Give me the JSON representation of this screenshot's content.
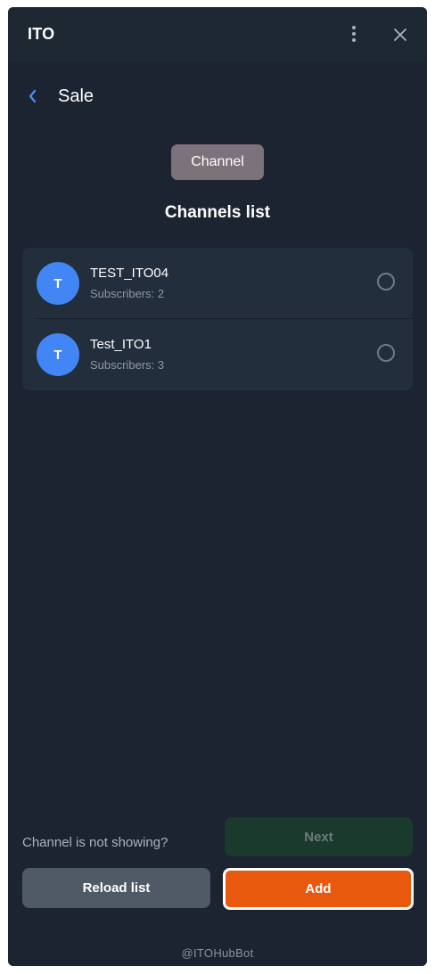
{
  "window": {
    "title": "ITO"
  },
  "header": {
    "title": "Sale"
  },
  "chip": {
    "label": "Channel"
  },
  "list": {
    "heading": "Channels list",
    "items": [
      {
        "avatar": "T",
        "name": "TEST_ITO04",
        "subscribers": "Subscribers: 2"
      },
      {
        "avatar": "T",
        "name": "Test_ITO1",
        "subscribers": "Subscribers: 3"
      }
    ]
  },
  "footer_actions": {
    "hint": "Channel is not showing?",
    "next_label": "Next",
    "reload_label": "Reload list",
    "add_label": "Add"
  },
  "footer": {
    "bot": "@ITOHubBot"
  },
  "icons": {
    "menu": "more-vertical-icon",
    "close": "close-icon",
    "back": "chevron-left-icon"
  },
  "colors": {
    "accent_blue": "#4285f4",
    "add_button": "#e8580d",
    "next_button_disabled": "#1a3a2e",
    "reload_button": "#505a67",
    "chip": "#7c7279"
  }
}
